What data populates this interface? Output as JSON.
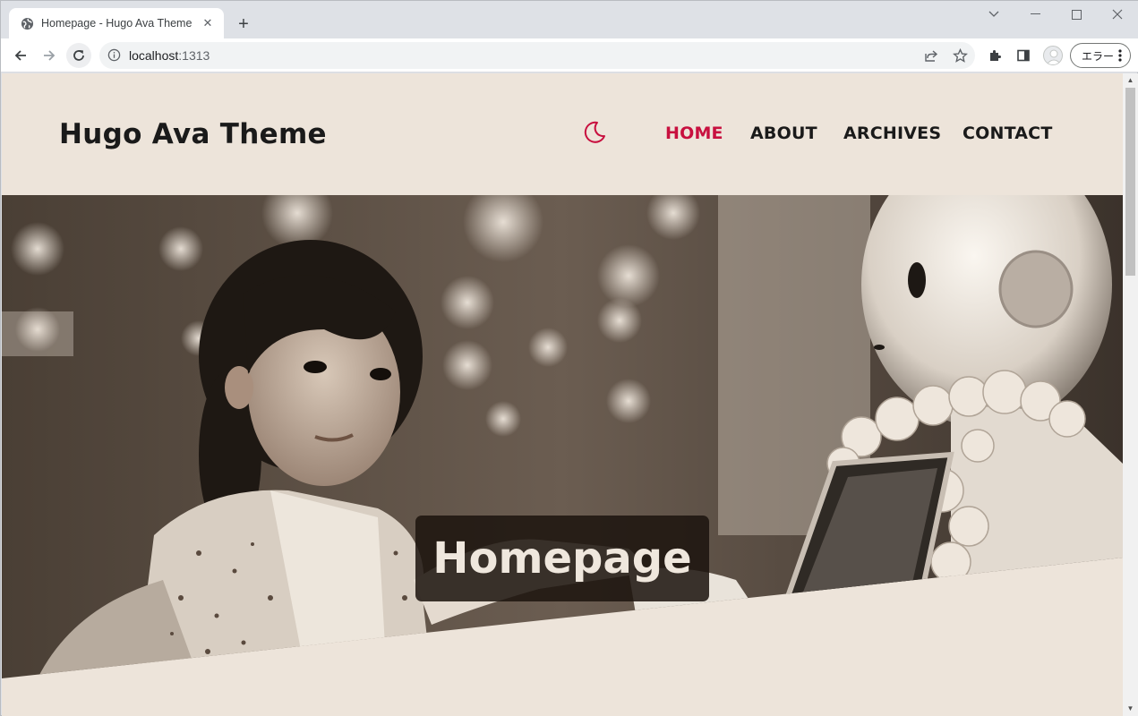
{
  "browser": {
    "tab_title": "Homepage - Hugo Ava Theme",
    "tab_close": "✕",
    "new_tab": "+",
    "url_host": "localhost",
    "url_port": ":1313",
    "error_button": "エラー"
  },
  "site": {
    "title": "Hugo Ava Theme",
    "nav": [
      {
        "label": "HOME",
        "active": true
      },
      {
        "label": "ABOUT",
        "active": false
      },
      {
        "label": "ARCHIVES",
        "active": false
      },
      {
        "label": "CONTACT",
        "active": false
      }
    ],
    "hero_title": "Homepage"
  },
  "colors": {
    "page_bg": "#ede4da",
    "accent": "#c8103f",
    "text": "#1a1a1a"
  },
  "icons": [
    "globe-icon",
    "close-icon",
    "plus-icon",
    "chevron-down-icon",
    "minimize-icon",
    "maximize-icon",
    "window-close-icon",
    "back-arrow-icon",
    "forward-arrow-icon",
    "reload-icon",
    "info-icon",
    "share-icon",
    "star-icon",
    "extensions-icon",
    "sidepanel-icon",
    "profile-icon",
    "kebab-menu-icon",
    "moon-icon"
  ]
}
